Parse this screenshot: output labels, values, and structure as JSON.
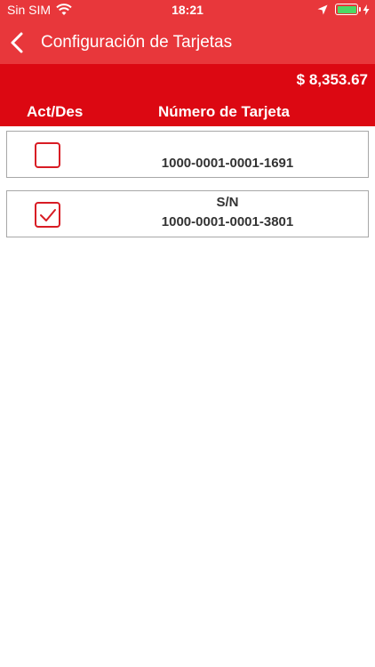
{
  "status": {
    "carrier": "Sin SIM",
    "time": "18:21",
    "battery_color": "#4cd964"
  },
  "nav": {
    "title": "Configuración de Tarjetas",
    "back_icon": "chevron-left-icon"
  },
  "balance": "$ 8,353.67",
  "table": {
    "headers": {
      "act": "Act/Des",
      "number": "Número de Tarjeta"
    },
    "rows": [
      {
        "label": "",
        "number": "1000-0001-0001-1691",
        "checked": false
      },
      {
        "label": "S/N",
        "number": "1000-0001-0001-3801",
        "checked": true
      }
    ]
  },
  "colors": {
    "nav": "#e8373b",
    "header": "#dc0812",
    "checkbox": "#d81c24"
  }
}
